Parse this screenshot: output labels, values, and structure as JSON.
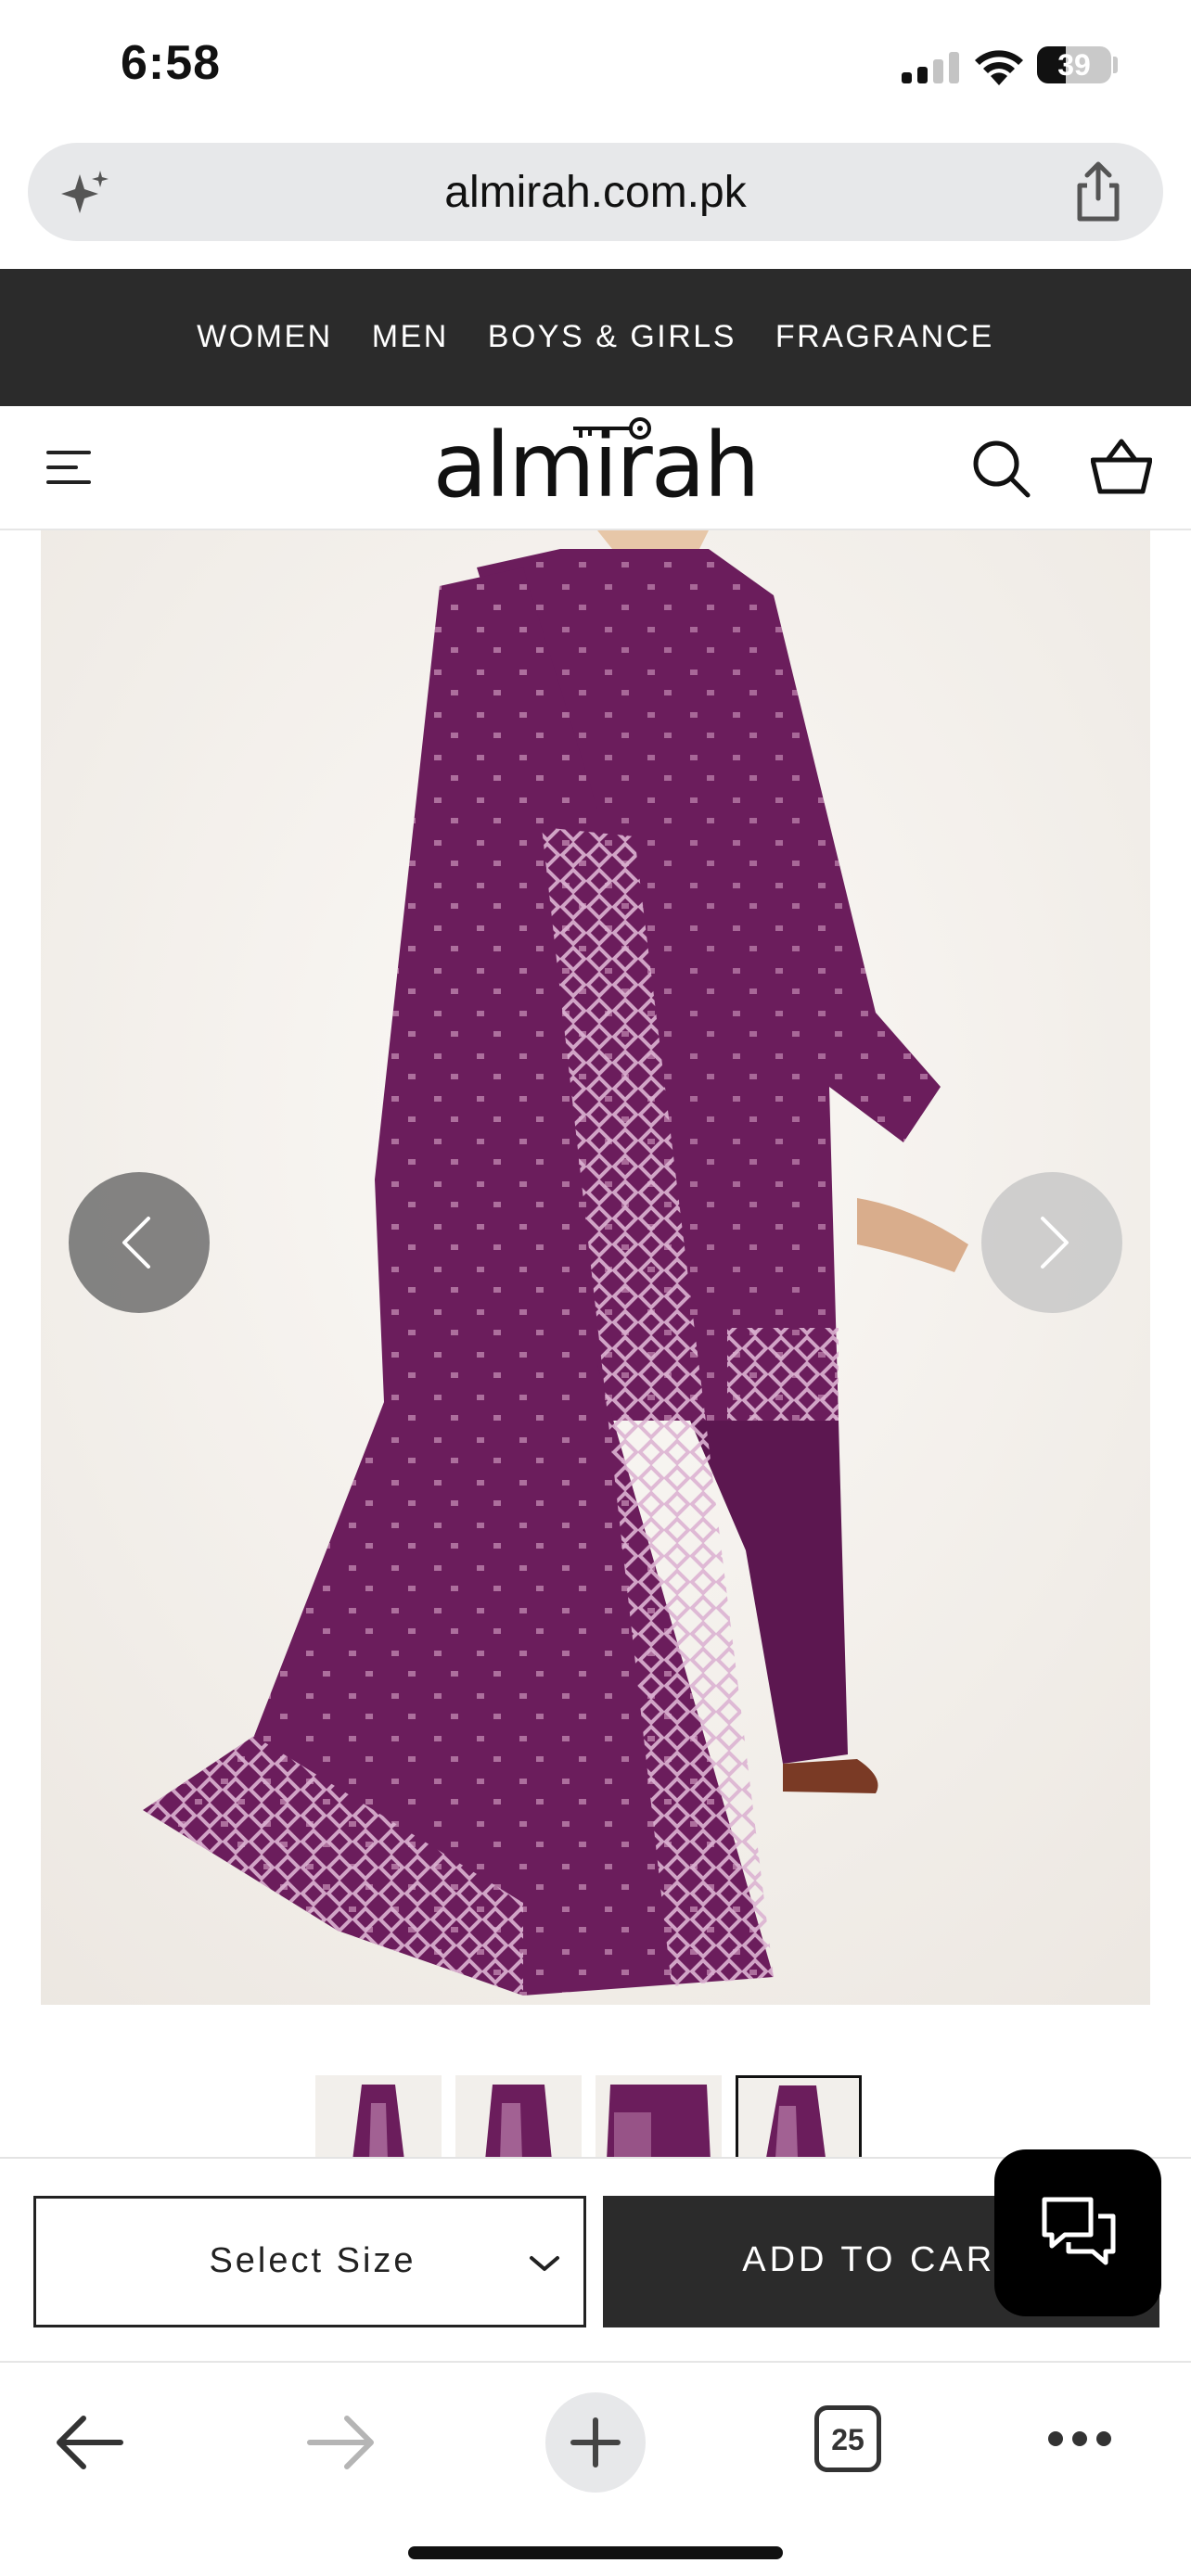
{
  "status_bar": {
    "time": "6:58",
    "battery_percent": "39",
    "battery_level": 0.39
  },
  "browser": {
    "url": "almirah.com.pk",
    "open_tabs": "25",
    "icons": [
      "sparkle-icon",
      "share-icon",
      "back-arrow-icon",
      "forward-arrow-icon",
      "plus-icon",
      "tabs-icon",
      "more-icon"
    ]
  },
  "category_nav": {
    "items": [
      "WOMEN",
      "MEN",
      "BOYS & GIRLS",
      "FRAGRANCE"
    ]
  },
  "header": {
    "logo_text": "almirah",
    "icons": [
      "menu-icon",
      "search-icon",
      "basket-icon"
    ]
  },
  "product": {
    "image_alt": "Purple printed three-piece suit with dupatta",
    "thumbnail_count": 4,
    "active_thumbnail": 4,
    "colors": {
      "fabric": "#6b1d5c",
      "print": "#d9a6c9",
      "background": "#f2efeb"
    }
  },
  "actions": {
    "size_select_label": "Select Size",
    "add_to_cart_label": "ADD TO CART"
  },
  "colors": {
    "dark_bar": "#2b2b2b",
    "url_bar": "#e7e8ea",
    "chat_button": "#000000"
  }
}
